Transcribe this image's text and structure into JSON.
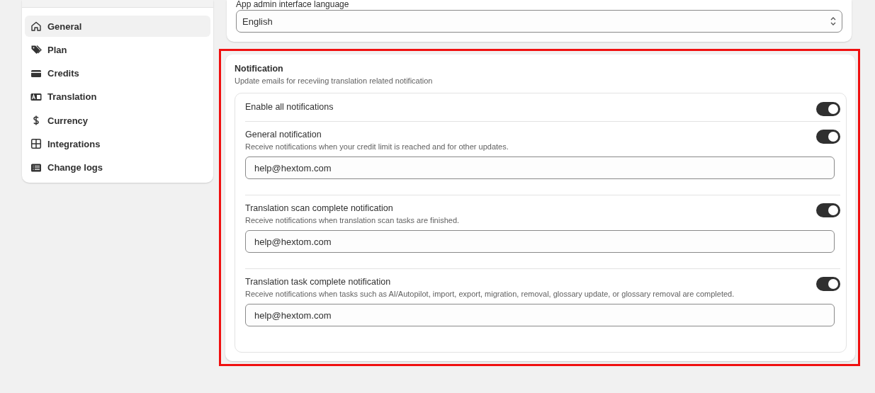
{
  "sidebar": {
    "items": [
      {
        "label": "General",
        "selected": true
      },
      {
        "label": "Plan",
        "selected": false
      },
      {
        "label": "Credits",
        "selected": false
      },
      {
        "label": "Translation",
        "selected": false
      },
      {
        "label": "Currency",
        "selected": false
      },
      {
        "label": "Integrations",
        "selected": false
      },
      {
        "label": "Change logs",
        "selected": false
      }
    ]
  },
  "language": {
    "label": "App admin interface language",
    "value": "English"
  },
  "notification": {
    "highlighted": true,
    "title": "Notification",
    "description": "Update emails for receviing translation related notification",
    "rows": [
      {
        "kind": "toggle",
        "title": "Enable all notifications",
        "on": true
      },
      {
        "kind": "email",
        "title": "General notification",
        "description": "Receive notifications when your credit limit is reached and for other updates.",
        "on": true,
        "value": "help@hextom.com"
      },
      {
        "kind": "email",
        "title": "Translation scan complete notification",
        "description": "Receive notifications when translation scan tasks are finished.",
        "on": true,
        "value": "help@hextom.com"
      },
      {
        "kind": "email",
        "title": "Translation task complete notification",
        "description": "Receive notifications when tasks such as AI/Autopilot, import, export, migration, removal, glossary update, or glossary removal are completed.",
        "on": true,
        "value": "help@hextom.com"
      }
    ]
  }
}
